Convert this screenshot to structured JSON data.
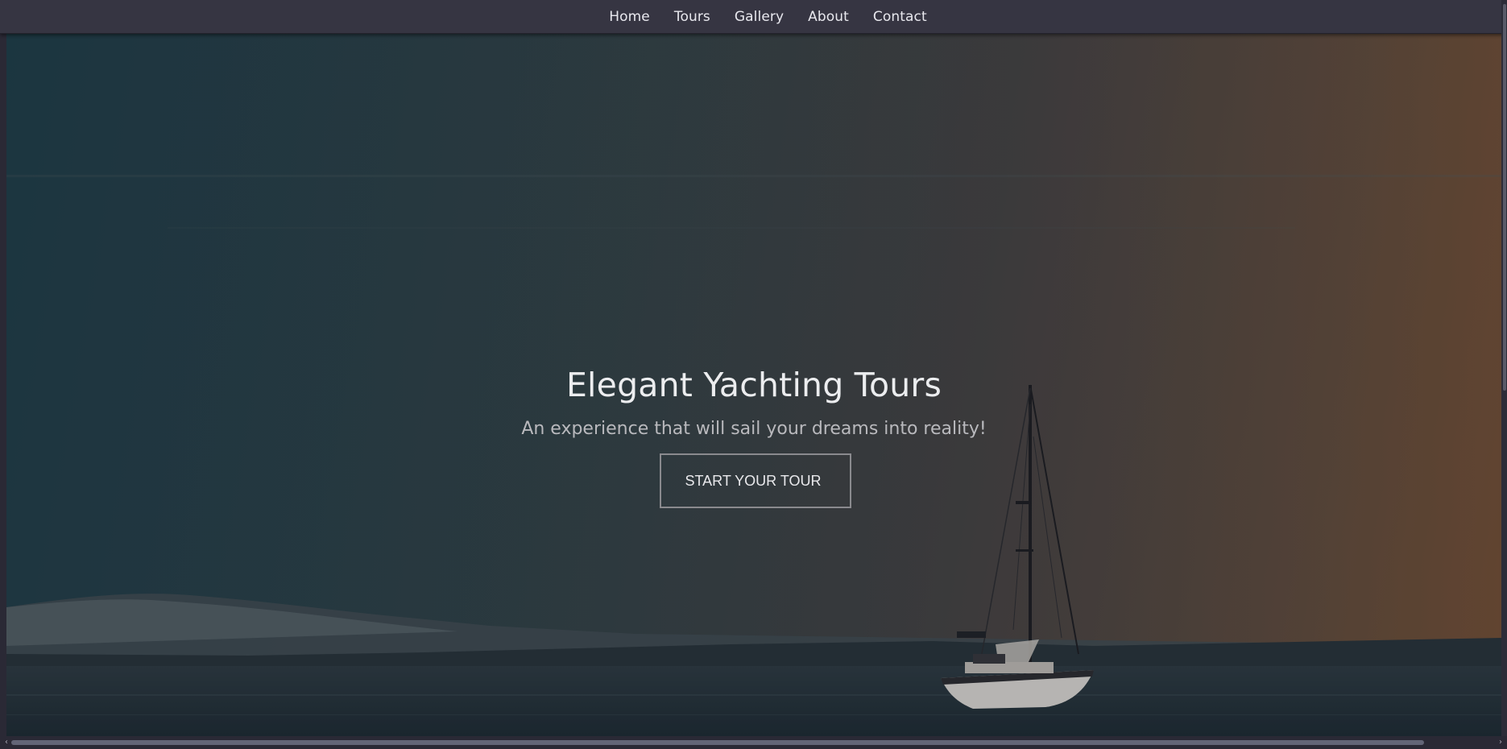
{
  "nav": {
    "items": [
      {
        "label": "Home"
      },
      {
        "label": "Tours"
      },
      {
        "label": "Gallery"
      },
      {
        "label": "About"
      },
      {
        "label": "Contact"
      }
    ]
  },
  "hero": {
    "title": "Elegant Yachting Tours",
    "subtitle": "An experience that will sail your dreams into reality!",
    "cta_label": "START YOUR TOUR"
  },
  "scrollbar": {
    "left_arrow": "‹",
    "right_arrow": "›"
  },
  "colors": {
    "navbar": "#363542",
    "sky_left": "#1d3d48",
    "sky_right": "#6b4c36",
    "title_text": "#ecedef",
    "button_border": "#8a8a8e"
  }
}
